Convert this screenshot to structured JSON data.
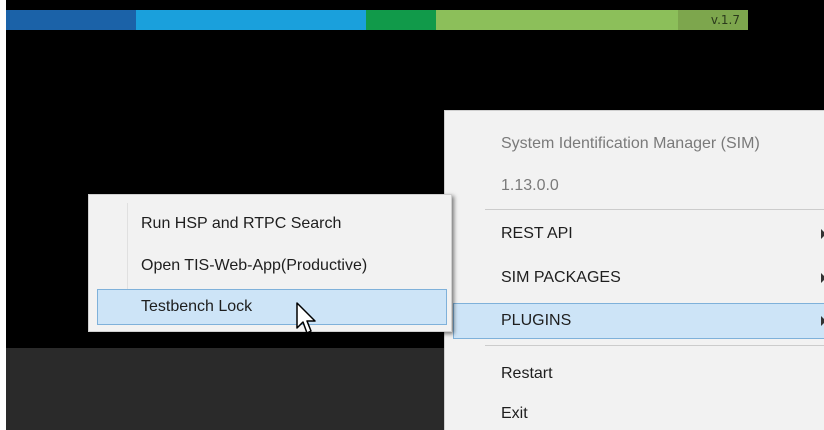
{
  "header": {
    "version": "v.1.7",
    "bar_colors": [
      "#1b62a8",
      "#1aa0dc",
      "#17a4d8",
      "#119a4a",
      "#73b53f",
      "#8cbf5a",
      "#7da64d"
    ]
  },
  "main_menu": {
    "app_title": "System Identification Manager (SIM)",
    "app_version": "1.13.0.0",
    "items": [
      {
        "label": "REST API",
        "has_submenu": true
      },
      {
        "label": "SIM PACKAGES",
        "has_submenu": true
      },
      {
        "label": "PLUGINS",
        "has_submenu": true,
        "highlighted": true
      },
      {
        "label": "Restart",
        "has_submenu": false
      },
      {
        "label": "Exit",
        "has_submenu": false
      }
    ]
  },
  "plugins_submenu": {
    "items": [
      {
        "label": "Run HSP and RTPC Search"
      },
      {
        "label": "Open TIS-Web-App(Productive)"
      },
      {
        "label": "Testbench Lock",
        "highlighted": true
      }
    ]
  },
  "colors": {
    "menu_bg": "#f2f2f2",
    "highlight_bg": "#cde4f7",
    "highlight_border": "#7fb1da"
  }
}
